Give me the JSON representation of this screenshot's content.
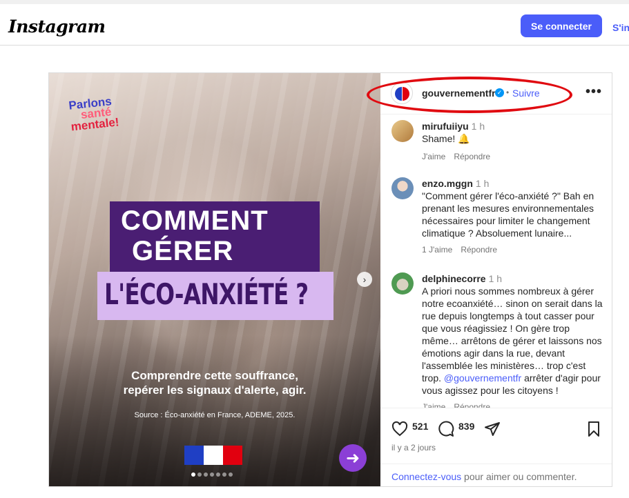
{
  "header": {
    "logo": "Instagram",
    "login_button": "Se connecter",
    "signup_link": "S'inscrire"
  },
  "media": {
    "brand_line1": "Parlons",
    "brand_line2": "santé",
    "brand_line3": "mentale!",
    "title_line1": "COMMENT",
    "title_line2": "GÉRER",
    "title_line3": "L'ÉCO-ANXIÉTÉ ?",
    "subtitle_line1": "Comprendre cette souffrance,",
    "subtitle_line2": "repérer les signaux d'alerte, agir.",
    "source": "Source : Éco-anxiété en France, ADEME, 2025.",
    "next_icon": "arrow-right-icon",
    "carousel_slides": 7,
    "carousel_active": 1
  },
  "post_header": {
    "username": "gouvernementfr",
    "separator": "•",
    "follow": "Suivre",
    "more": "•••"
  },
  "comments": [
    {
      "user": "mirufuiiyu",
      "time": "1 h",
      "text": "Shame! 🔔",
      "likes_label": "J'aime",
      "reply": "Répondre"
    },
    {
      "user": "enzo.mggn",
      "time": "1 h",
      "text": "\"Comment gérer l'éco-anxiété ?\" Bah en prenant les mesures environnementales nécessaires pour limiter le changement climatique ? Absoluement lunaire...",
      "likes_label": "1 J'aime",
      "reply": "Répondre"
    },
    {
      "user": "delphinecorre",
      "time": "1 h",
      "text_before": "A priori nous sommes nombreux à gérer notre ecoanxiété… sinon on serait dans la rue depuis longtemps à tout casser pour que vous réagissiez ! On gère trop même… arrêtons de gérer et laissons nos émotions agir dans la rue, devant l'assemblée les ministères… trop c'est trop. ",
      "mention": "@gouvernementfr",
      "text_after": " arrêter d'agir pour vous agissez pour les citoyens !",
      "likes_label": "J'aime",
      "reply": "Répondre"
    }
  ],
  "actions": {
    "likes": "521",
    "comments": "839",
    "date": "il y a 2 jours",
    "login_link": "Connectez-vous",
    "login_rest": " pour aimer ou commenter."
  },
  "colors": {
    "accent": "#4a5df9",
    "highlight": "#e00a10",
    "title_bg": "#4a1e73",
    "eco_bg": "#d8b8f0"
  }
}
